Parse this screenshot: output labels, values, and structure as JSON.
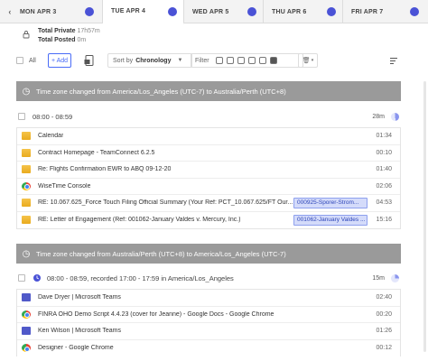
{
  "tabs": [
    {
      "label": "MON APR 3",
      "active": false,
      "dot": "#4a52d6"
    },
    {
      "label": "TUE APR 4",
      "active": true,
      "dot": "#4a52d6"
    },
    {
      "label": "WED APR 5",
      "active": false,
      "dot": "#4a52d6"
    },
    {
      "label": "THU APR 6",
      "active": false,
      "dot": "#4a52d6"
    },
    {
      "label": "FRI APR 7",
      "active": false,
      "dot": "#4a52d6"
    }
  ],
  "totals": {
    "private_label": "Total Private",
    "private_value": "17h57m",
    "posted_label": "Total Posted",
    "posted_value": "0m"
  },
  "toolbar": {
    "all_label": "All",
    "add_label": "+ Add",
    "sort_prefix": "Sort by",
    "sort_value": "Chronology",
    "filter_label": "Filter"
  },
  "banners": [
    {
      "text": "Time zone changed from America/Los_Angeles (UTC-7) to Australia/Perth (UTC+8)"
    },
    {
      "text": "Time zone changed from Australia/Perth (UTC+8) to America/Los_Angeles (UTC-7)"
    }
  ],
  "groups": [
    {
      "header": "08:00 - 08:59",
      "duration": "28m",
      "items": [
        {
          "icon": "folder-icon",
          "title": "Calendar",
          "time": "01:34",
          "tag": ""
        },
        {
          "icon": "folder-icon",
          "title": "Contract Homepage - TeamConnect 6.2.5",
          "time": "00:10",
          "tag": ""
        },
        {
          "icon": "folder-icon",
          "title": "Re: Flights Confirmation EWR to ABQ 09-12-20",
          "time": "01:40",
          "tag": ""
        },
        {
          "icon": "chrome-icon",
          "title": "WiseTime Console",
          "time": "02:06",
          "tag": ""
        },
        {
          "icon": "folder-icon",
          "title": "RE: 10.067.625_Force Touch Filing Official Summary (Your Ref: PCT_10.067.625/FT Our...",
          "time": "04:53",
          "tag": "000925-Sporer-Strom..."
        },
        {
          "icon": "folder-icon",
          "title": "RE: Letter of Engagement (Ref: 001062-January Valdes v. Mercury, Inc.)",
          "time": "15:16",
          "tag": "001062-January Valdes ..."
        }
      ]
    },
    {
      "header": "08:00 - 08:59, recorded 17:00 - 17:59 in America/Los_Angeles",
      "duration": "15m",
      "items": [
        {
          "icon": "teams-icon",
          "title": "Dave Dryer | Microsoft Teams",
          "time": "02:40",
          "tag": ""
        },
        {
          "icon": "chrome-icon",
          "title": "FINRA OHO Demo Script 4.4.23 (cover for Jeanne) - Google Docs - Google Chrome",
          "time": "00:20",
          "tag": ""
        },
        {
          "icon": "teams-icon",
          "title": "Ken Wilson | Microsoft Teams",
          "time": "01:26",
          "tag": ""
        },
        {
          "icon": "chrome-icon",
          "title": "Designer - Google Chrome",
          "time": "00:12",
          "tag": ""
        }
      ]
    }
  ]
}
